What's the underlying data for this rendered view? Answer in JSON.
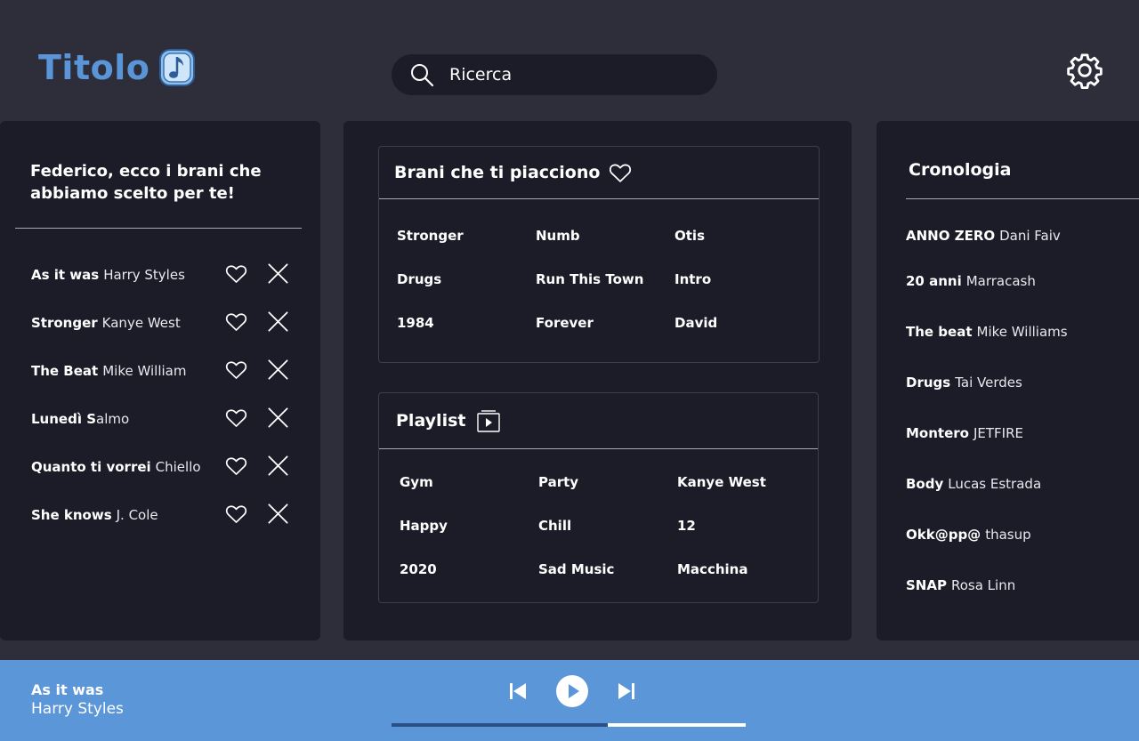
{
  "header": {
    "logo_text": "Titolo",
    "search_placeholder": "Ricerca"
  },
  "recommendations": {
    "title": "Federico, ecco i brani che abbiamo scelto per te!",
    "items": [
      {
        "title": "As it was",
        "artist": "Harry Styles"
      },
      {
        "title": "Stronger",
        "artist": "Kanye West"
      },
      {
        "title": "The Beat",
        "artist": "Mike William"
      },
      {
        "title": "Lunedì S",
        "artist": "almo"
      },
      {
        "title": "Quanto ti vorrei",
        "artist": "Chiello"
      },
      {
        "title": "She knows",
        "artist": "J. Cole"
      }
    ]
  },
  "liked": {
    "title": "Brani che ti piacciono",
    "songs": [
      "Stronger",
      "Numb",
      "Otis",
      "Drugs",
      "Run This Town",
      "Intro",
      "1984",
      "Forever",
      "David"
    ]
  },
  "playlists": {
    "title": "Playlist",
    "items": [
      "Gym",
      "Party",
      "Kanye West",
      "Happy",
      "Chill",
      "12",
      "2020",
      "Sad Music",
      "Macchina"
    ]
  },
  "history": {
    "title": "Cronologia",
    "items": [
      {
        "title": "ANNO ZERO",
        "artist": "Dani Faiv"
      },
      {
        "title": "20 anni",
        "artist": "Marracash"
      },
      {
        "title": "The beat",
        "artist": "Mike Williams"
      },
      {
        "title": "Drugs",
        "artist": "Tai Verdes"
      },
      {
        "title": "Montero",
        "artist": "JETFIRE"
      },
      {
        "title": "Body",
        "artist": "Lucas Estrada"
      },
      {
        "title": "Okk@pp@",
        "artist": "thasup"
      },
      {
        "title": "SNAP",
        "artist": "Rosa Linn"
      }
    ]
  },
  "player": {
    "title": "As it was",
    "artist": "Harry Styles",
    "progress": 0.61
  },
  "colors": {
    "background": "#2d2e3a",
    "panel": "#1b1c27",
    "accent": "#5b96d9",
    "progress_played": "#2d4f86"
  },
  "icons": {
    "logo": "music-note-icon",
    "search": "search-icon",
    "settings": "gear-icon",
    "like": "heart-icon",
    "dismiss": "close-icon",
    "playlist": "play-box-icon",
    "previous": "skip-previous-icon",
    "play": "play-icon",
    "next": "skip-next-icon"
  }
}
